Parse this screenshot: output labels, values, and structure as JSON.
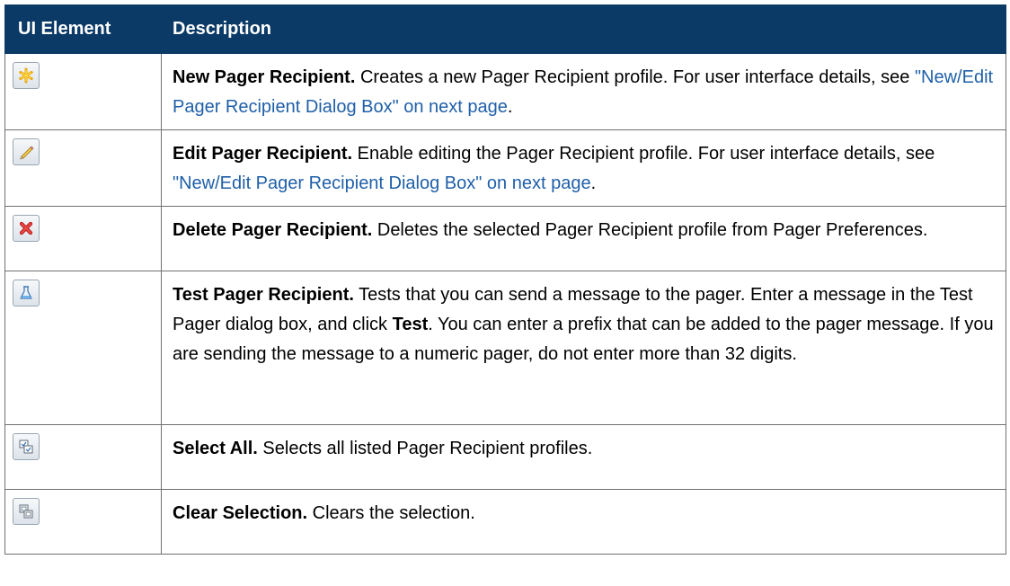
{
  "header": {
    "col_element": "UI Element",
    "col_description": "Description"
  },
  "rows": [
    {
      "icon": "new-star-icon",
      "term": "New Pager Recipient.",
      "text": " Creates a new Pager Recipient profile. For user interface details, see ",
      "link": "\"New/Edit Pager Recipient Dialog Box\" on next page",
      "after": "."
    },
    {
      "icon": "pencil-icon",
      "term": "Edit Pager Recipient.",
      "text": " Enable editing the Pager Recipient profile. For user interface details, see ",
      "link": "\"New/Edit Pager Recipient Dialog Box\" on next page",
      "after": "."
    },
    {
      "icon": "delete-x-icon",
      "term": "Delete Pager Recipient.",
      "text": " Deletes the selected Pager Recipient profile from Pager Preferences."
    },
    {
      "icon": "test-flask-icon",
      "term": "Test Pager Recipient.",
      "text": " Tests that you can send a message to the pager. Enter a message in the Test Pager dialog box, and click ",
      "bold": "Test",
      "text2": ". You can enter a prefix that can be added to the pager message. If you are sending the message to a numeric pager, do not enter more than 32 digits."
    },
    {
      "icon": "select-all-icon",
      "term": "Select All.",
      "text": " Selects all listed Pager Recipient profiles."
    },
    {
      "icon": "clear-selection-icon",
      "term": "Clear Selection.",
      "text": " Clears the selection."
    }
  ],
  "colors": {
    "header_bg": "#0b3a66",
    "link": "#1f5fa8",
    "border": "#707070"
  }
}
